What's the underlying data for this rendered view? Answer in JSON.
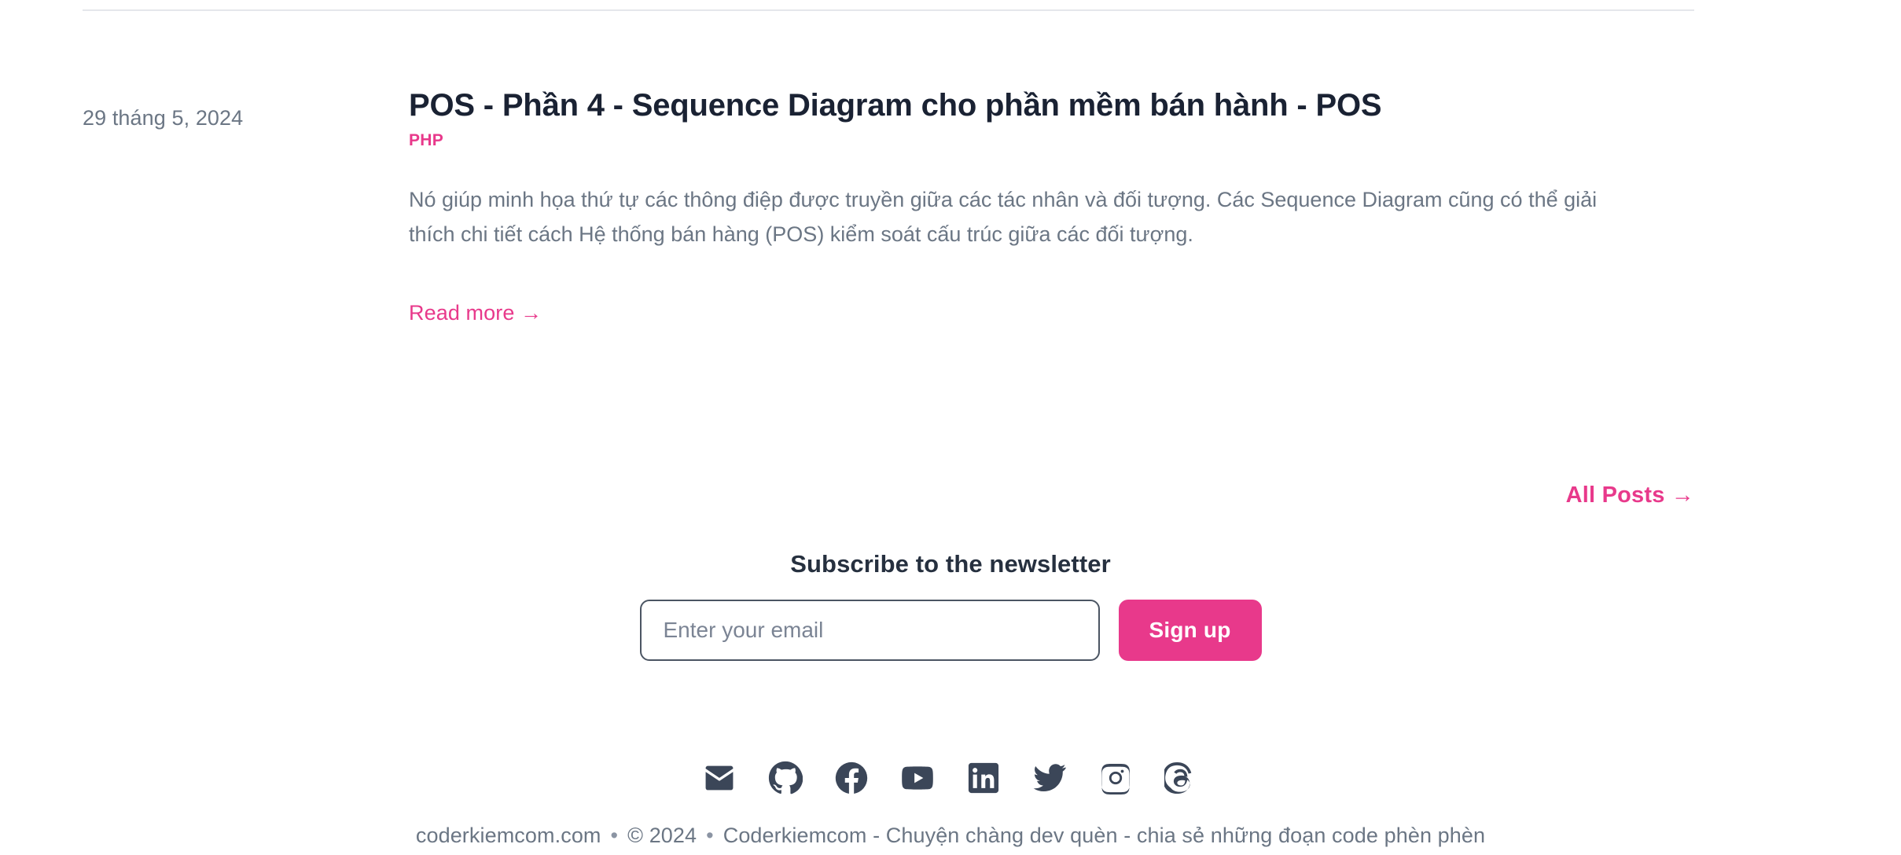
{
  "post": {
    "date": "29 tháng 5, 2024",
    "title": "POS - Phần 4 - Sequence Diagram cho phần mềm bán hành - POS",
    "tag": "PHP",
    "excerpt": "Nó giúp minh họa thứ tự các thông điệp được truyền giữa các tác nhân và đối tượng. Các Sequence Diagram cũng có thể giải thích chi tiết cách Hệ thống bán hàng (POS) kiểm soát cấu trúc giữa các đối tượng.",
    "read_more_label": "Read more →"
  },
  "all_posts": {
    "label": "All Posts →"
  },
  "newsletter": {
    "title": "Subscribe to the newsletter",
    "email_placeholder": "Enter your email",
    "email_value": "",
    "signup_label": "Sign up"
  },
  "socials": [
    {
      "name": "mail-icon",
      "label": "Email"
    },
    {
      "name": "github-icon",
      "label": "GitHub"
    },
    {
      "name": "facebook-icon",
      "label": "Facebook"
    },
    {
      "name": "youtube-icon",
      "label": "YouTube"
    },
    {
      "name": "linkedin-icon",
      "label": "LinkedIn"
    },
    {
      "name": "twitter-icon",
      "label": "Twitter"
    },
    {
      "name": "instagram-icon",
      "label": "Instagram"
    },
    {
      "name": "threads-icon",
      "label": "Threads"
    }
  ],
  "footer": {
    "site_name": "coderkiemcom.com",
    "separator": "•",
    "copyright": "© 2024",
    "tagline": "Coderkiemcom - Chuyện chàng dev quèn - chia sẻ những đoạn code phèn phèn"
  },
  "colors": {
    "accent_pink": "#e8398b",
    "text_dark": "#1a2233",
    "text_muted": "#6b7684",
    "divider": "#e5e7eb"
  }
}
